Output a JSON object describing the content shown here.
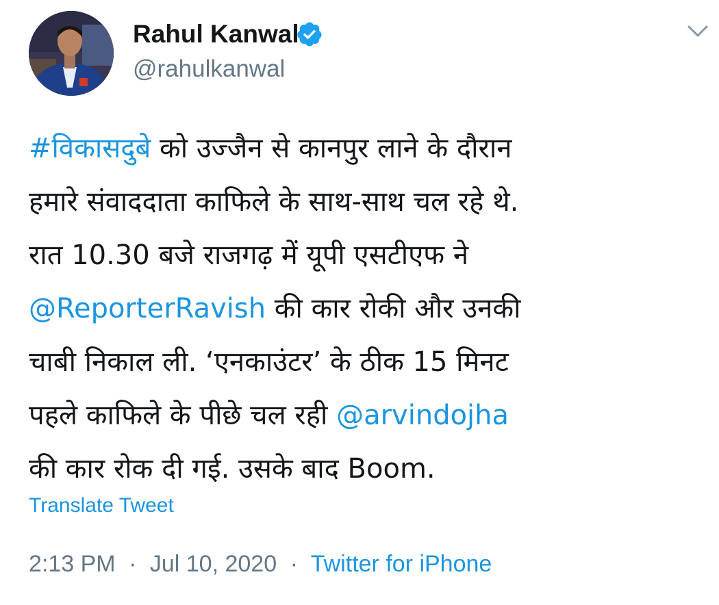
{
  "author": {
    "name": "Rahul Kanwal",
    "handle": "@rahulkanwal",
    "verified_color": "#1da1f2"
  },
  "tweet": {
    "lines": [
      [
        {
          "text": "#विकासदुबे",
          "type": "hashtag"
        },
        {
          "text": " को उज्जैन से कानपुर लाने के दौरान",
          "type": "text"
        }
      ],
      [
        {
          "text": "हमारे संवाददाता काफिले के साथ-साथ चल रहे थे.",
          "type": "text"
        }
      ],
      [
        {
          "text": "रात 10.30 बजे राजगढ़ में यूपी एसटीएफ ने",
          "type": "text"
        }
      ],
      [
        {
          "text": "@ReporterRavish",
          "type": "mention"
        },
        {
          "text": " की कार रोकी और उनकी",
          "type": "text"
        }
      ],
      [
        {
          "text": "चाबी निकाल ली. ‘एनकाउंटर’ के ठीक 15 मिनट",
          "type": "text"
        }
      ],
      [
        {
          "text": "पहले काफिले के पीछे चल रही ",
          "type": "text"
        },
        {
          "text": "@arvindojha",
          "type": "mention"
        }
      ],
      [
        {
          "text": "की कार रोक दी गई. उसके बाद Boom.",
          "type": "text"
        }
      ]
    ],
    "translate_label": "Translate Tweet",
    "time": "2:13 PM",
    "date": "Jul 10, 2020",
    "separator": "·",
    "source": "Twitter for iPhone"
  },
  "colors": {
    "link": "#1b95e0",
    "secondary_text": "#657786",
    "primary_text": "#14171a"
  },
  "icons": {
    "verified": "verified-badge-icon",
    "menu": "chevron-down-icon"
  }
}
